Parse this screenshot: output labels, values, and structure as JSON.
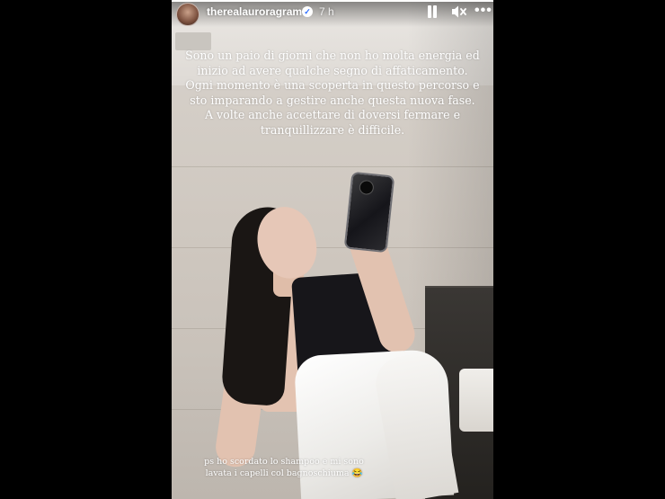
{
  "story": {
    "username": "therealauroragram",
    "verified": true,
    "time_ago": "7 h",
    "progress_fraction": 1.0,
    "caption_main": "Sono un paio di giorni che non ho molta energia ed inizio ad avere qualche segno di affaticamento. Ogni momento è una scoperta in questo percorso e sto imparando a gestire anche questa nuova fase. A volte anche accettare di doversi fermare e tranquillizzare è difficile.",
    "caption_ps": "ps ho scordato lo shampoo e mi sono lavata i capelli col bagnoschiuma 😂"
  },
  "icons": {
    "verified": "verified-badge-icon",
    "pause": "pause-icon",
    "mute": "volume-muted-icon",
    "more": "more-options-icon"
  },
  "colors": {
    "background": "#000000",
    "text": "#ffffff",
    "verified": "#2b6cff"
  }
}
